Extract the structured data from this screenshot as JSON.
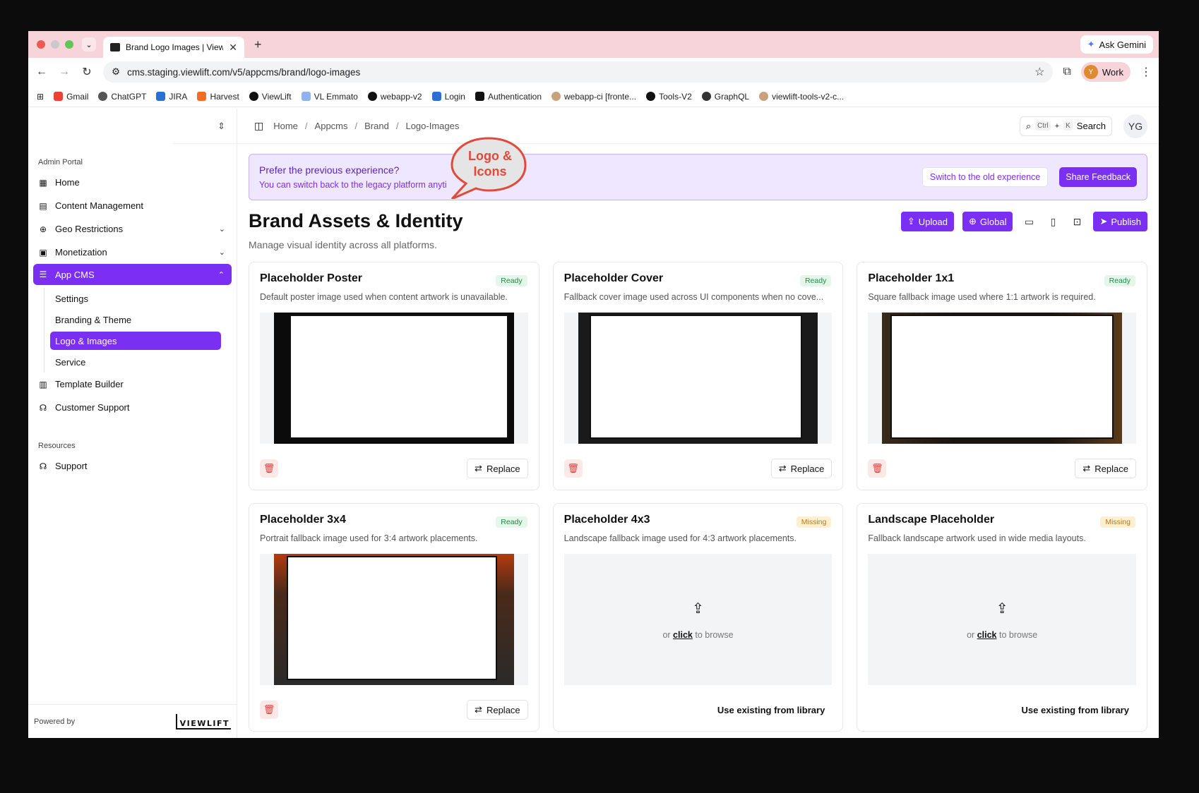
{
  "browser": {
    "tab_title": "Brand Logo Images | ViewLift",
    "ask_gemini": "Ask Gemini",
    "url": "cms.staging.viewlift.com/v5/appcms/brand/logo-images",
    "profile_initial": "Y",
    "profile_label": "Work",
    "bookmarks": [
      "Gmail",
      "ChatGPT",
      "JIRA",
      "Harvest",
      "ViewLift",
      "VL Emmato",
      "webapp-v2",
      "Login",
      "Authentication",
      "webapp-ci [fronte...",
      "Tools-V2",
      "GraphQL",
      "viewlift-tools-v2-c..."
    ]
  },
  "sidebar": {
    "section_admin": "Admin Portal",
    "items": [
      {
        "label": "Home",
        "icon": "grid-icon"
      },
      {
        "label": "Content Management",
        "icon": "film-icon"
      },
      {
        "label": "Geo Restrictions",
        "icon": "globe-icon"
      },
      {
        "label": "Monetization",
        "icon": "wallet-icon"
      },
      {
        "label": "App CMS",
        "icon": "sliders-icon"
      }
    ],
    "sub_items": [
      "Settings",
      "Branding & Theme",
      "Logo & Images",
      "Service"
    ],
    "items_after": [
      {
        "label": "Template Builder",
        "icon": "layout-icon"
      },
      {
        "label": "Customer Support",
        "icon": "headset-icon"
      }
    ],
    "section_resources": "Resources",
    "support": "Support",
    "powered_by": "Powered by",
    "brand": "VIEWLIFT"
  },
  "topbar": {
    "breadcrumb": [
      "Home",
      "Appcms",
      "Brand",
      "Logo-Images"
    ],
    "search_kbd1": "Ctrl",
    "search_plus": "+",
    "search_kbd2": "K",
    "search_label": "Search",
    "avatar": "YG"
  },
  "banner": {
    "heading": "Prefer the previous experience?",
    "sub": "You can switch back to the legacy platform anyti",
    "switch_label": "Switch to the old experience",
    "feedback_label": "Share Feedback"
  },
  "callout": {
    "line1": "Logo &",
    "line2": "Icons"
  },
  "page": {
    "title": "Brand Assets & Identity",
    "subtitle": "Manage visual identity across all platforms.",
    "upload": "Upload",
    "global": "Global",
    "publish": "Publish"
  },
  "cards": [
    {
      "title": "Placeholder Poster",
      "status": "Ready",
      "desc": "Default poster image used when content artwork is unavailable."
    },
    {
      "title": "Placeholder Cover",
      "status": "Ready",
      "desc": "Fallback cover image used across UI components when no cove..."
    },
    {
      "title": "Placeholder 1x1",
      "status": "Ready",
      "desc": "Square fallback image used where 1:1 artwork is required."
    },
    {
      "title": "Placeholder 3x4",
      "status": "Ready",
      "desc": "Portrait fallback image used for 3:4 artwork placements."
    },
    {
      "title": "Placeholder 4x3",
      "status": "Missing",
      "desc": "Landscape fallback image used for 4:3 artwork placements."
    },
    {
      "title": "Landscape Placeholder",
      "status": "Missing",
      "desc": "Fallback landscape artwork used in wide media layouts."
    }
  ],
  "card_actions": {
    "replace": "Replace",
    "or": "or",
    "click": "click",
    "to_browse": "to browse",
    "use_library": "Use existing from library"
  },
  "colors": {
    "accent": "#7b2ff2",
    "tabstrip": "#f6d4d9",
    "ready": "#1f8a45",
    "missing": "#b7791f"
  }
}
